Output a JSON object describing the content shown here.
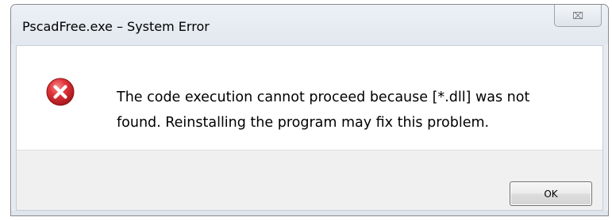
{
  "window": {
    "title": "PscadFree.exe – System Error",
    "close_glyph": "⌧",
    "close_icon": "close-icon"
  },
  "dialog": {
    "icon": "error-icon",
    "message_line1": "The code execution cannot proceed because [*.dll] was not",
    "message_line2": "found. Reinstalling the program may fix this problem.",
    "ok_label": "OK"
  },
  "colors": {
    "error_red": "#d8262b",
    "footer_bg": "#f0f0f0",
    "chrome_bg": "#e6ebf1"
  }
}
